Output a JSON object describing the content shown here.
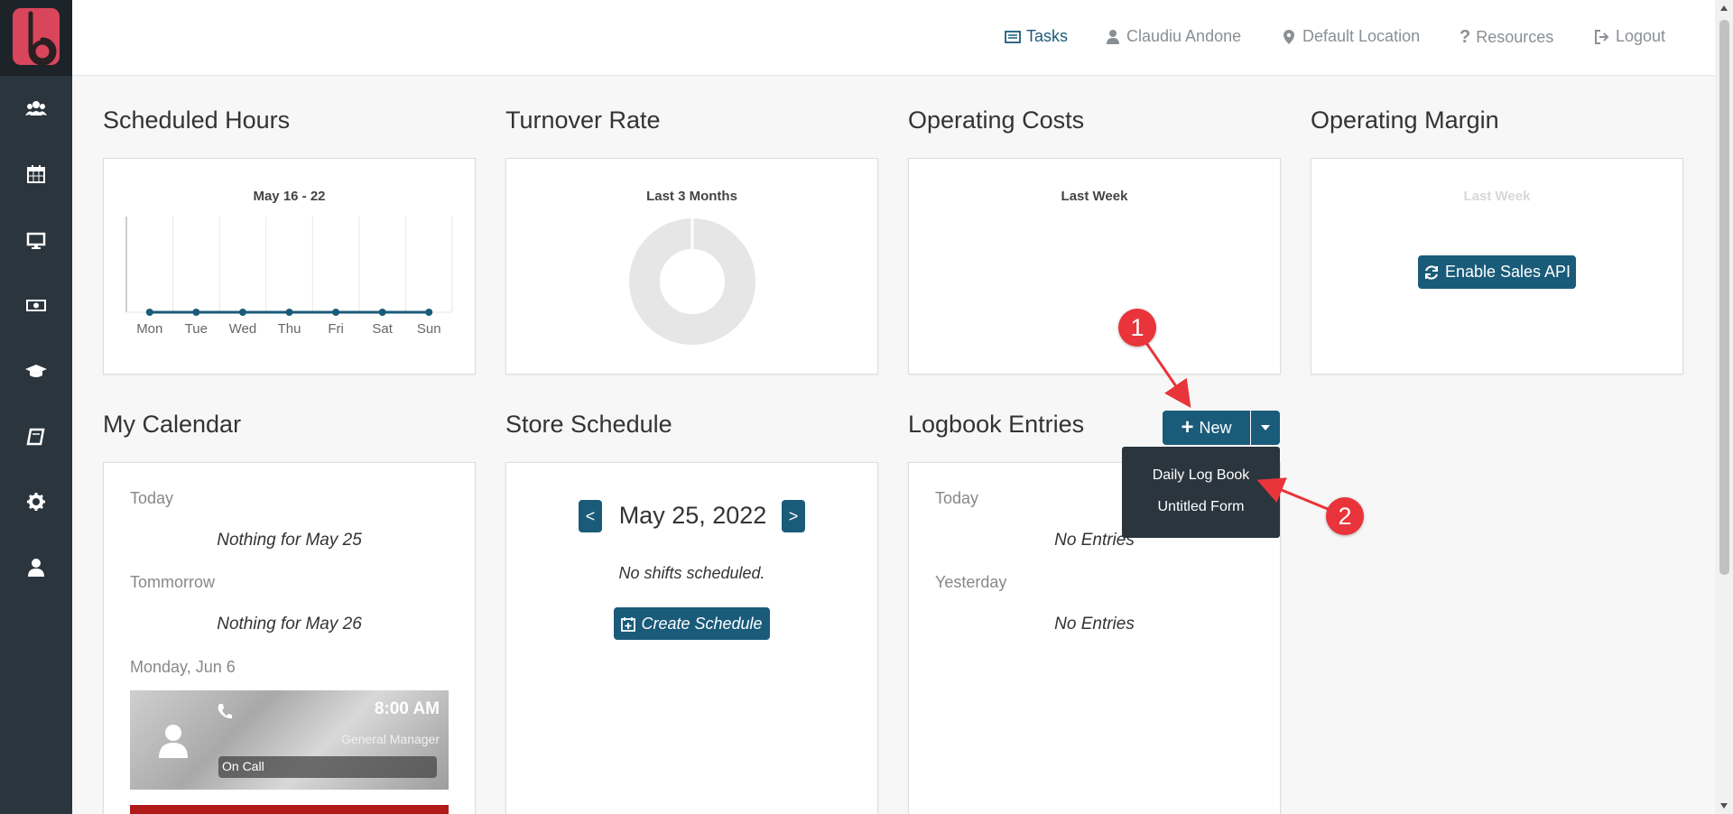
{
  "nav": {
    "tasks": "Tasks",
    "user": "Claudiu Andone",
    "location": "Default Location",
    "resources": "Resources",
    "logout": "Logout"
  },
  "sidebar": {
    "icons": [
      "people-icon",
      "calendar-icon",
      "monitor-icon",
      "money-icon",
      "graduation-cap-icon",
      "book-icon",
      "gear-icon",
      "user-icon"
    ]
  },
  "scheduled_hours": {
    "title": "Scheduled Hours",
    "subtitle": "May 16 - 22"
  },
  "turnover_rate": {
    "title": "Turnover Rate",
    "subtitle": "Last 3 Months"
  },
  "operating_costs": {
    "title": "Operating Costs",
    "subtitle": "Last Week"
  },
  "operating_margin": {
    "title": "Operating Margin",
    "subtitle": "Last Week",
    "button": "Enable Sales API"
  },
  "my_calendar": {
    "title": "My Calendar",
    "today_label": "Today",
    "today_text": "Nothing for May 25",
    "tomorrow_label": "Tommorrow",
    "tomorrow_text": "Nothing for May 26",
    "monday_label": "Monday, Jun 6",
    "event": {
      "time": "8:00 AM",
      "role": "General Manager",
      "status": "On Call"
    }
  },
  "store_schedule": {
    "title": "Store Schedule",
    "date": "May 25, 2022",
    "prev": "<",
    "next": ">",
    "empty": "No shifts scheduled.",
    "button": "Create Schedule"
  },
  "logbook": {
    "title": "Logbook Entries",
    "new_button": "New",
    "today_label": "Today",
    "today_text": "No Entries",
    "yesterday_label": "Yesterday",
    "yesterday_text": "No Entries",
    "dropdown": [
      "Daily Log Book",
      "Untitled Form"
    ]
  },
  "annotations": {
    "marker1": "1",
    "marker2": "2"
  },
  "chart_data": {
    "type": "line",
    "title": "May 16 - 22",
    "categories": [
      "Mon",
      "Tue",
      "Wed",
      "Thu",
      "Fri",
      "Sat",
      "Sun"
    ],
    "values": [
      0,
      0,
      0,
      0,
      0,
      0,
      0
    ],
    "grid": true,
    "color": "#1a5b7a"
  },
  "colors": {
    "accent": "#1a5b7a",
    "sidebar": "#2a353e",
    "brand": "#d9455a",
    "marker": "#e8343a"
  }
}
